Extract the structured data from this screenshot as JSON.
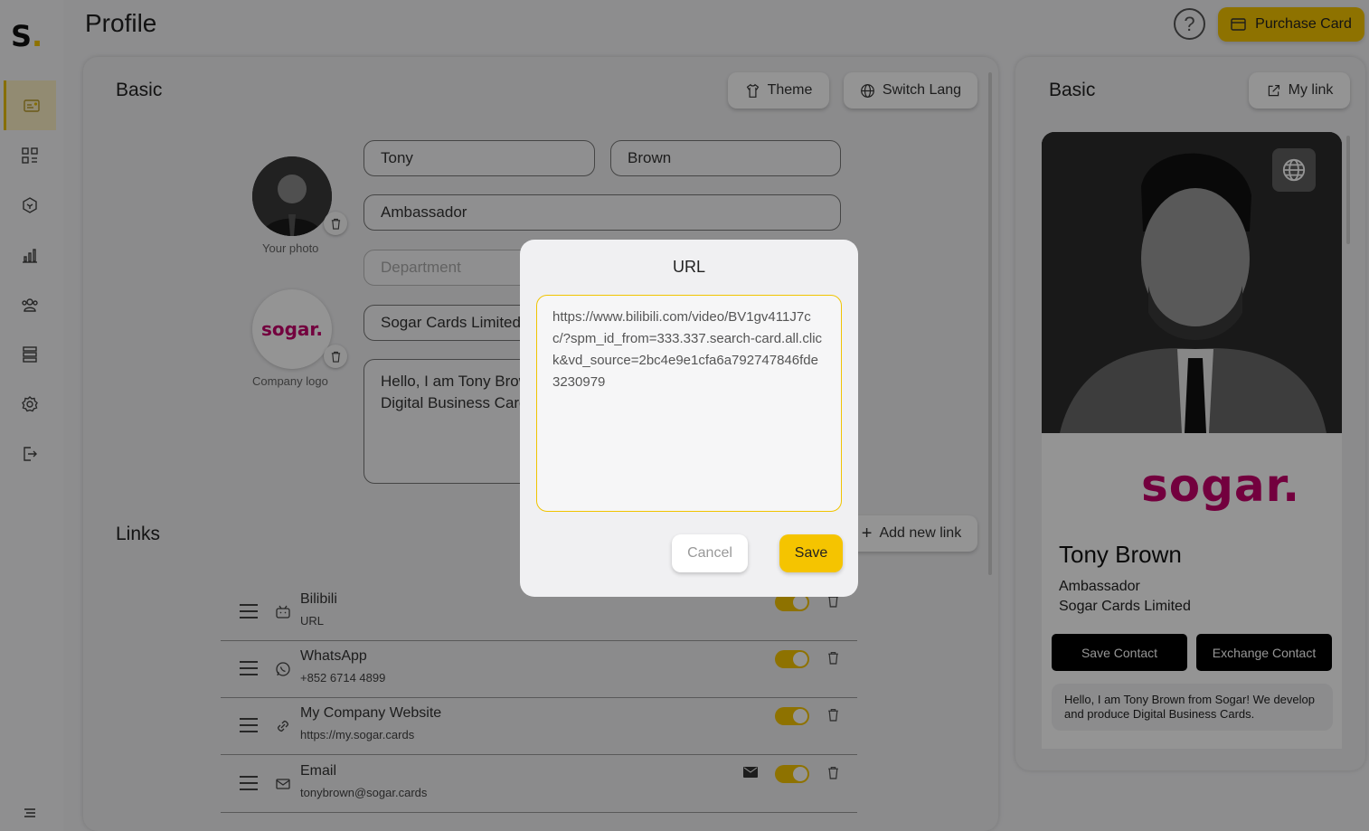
{
  "header": {
    "logo_text": "S",
    "logo_dot": ".",
    "title": "Profile",
    "help_symbol": "?",
    "purchase_label": "Purchase Card",
    "accent_color": "#f5c400"
  },
  "sidebar": {
    "items": [
      {
        "icon": "profile-card-icon",
        "active": true
      },
      {
        "icon": "apps-grid-icon",
        "active": false
      },
      {
        "icon": "hexagon-icon",
        "active": false
      },
      {
        "icon": "bar-chart-icon",
        "active": false
      },
      {
        "icon": "users-icon",
        "active": false
      },
      {
        "icon": "layers-icon",
        "active": false
      },
      {
        "icon": "settings-icon",
        "active": false
      },
      {
        "icon": "logout-icon",
        "active": false
      },
      {
        "icon": "menu-icon",
        "active": false
      }
    ]
  },
  "basic": {
    "title": "Basic",
    "theme_label": "Theme",
    "switch_lang_label": "Switch Lang",
    "photo_caption": "Your photo",
    "company_logo_caption": "Company logo",
    "company_logo_text": "sogar.",
    "first_name": "Tony",
    "last_name": "Brown",
    "job_title": "Ambassador",
    "department_placeholder": "Department",
    "company": "Sogar Cards Limited",
    "bio": "Hello, I am Tony Brown from Sogar! We develop and produce Digital Business Cards."
  },
  "links": {
    "title": "Links",
    "add_label": "Add new link",
    "rows": [
      {
        "label": "Bilibili",
        "value": "URL",
        "icon": "bilibili-icon",
        "enabled": true
      },
      {
        "label": "WhatsApp",
        "value": "+852 6714 4899",
        "icon": "whatsapp-icon",
        "enabled": true
      },
      {
        "label": "My Company Website",
        "value": "https://my.sogar.cards",
        "icon": "link-icon",
        "enabled": true
      },
      {
        "label": "Email",
        "value": "tonybrown@sogar.cards",
        "icon": "email-icon",
        "enabled": true
      }
    ]
  },
  "preview": {
    "title": "Basic",
    "my_link_label": "My link",
    "logo_text": "sogar.",
    "name": "Tony Brown",
    "job_title": "Ambassador",
    "company": "Sogar Cards Limited",
    "save_contact_label": "Save Contact",
    "exchange_contact_label": "Exchange Contact",
    "bio": "Hello, I am Tony Brown from Sogar! We develop and produce Digital Business Cards.",
    "brand_color": "#c7006b"
  },
  "modal": {
    "title": "URL",
    "url_value": "https://www.bilibili.com/video/BV1gv411J7cc/?spm_id_from=333.337.search-card.all.click&vd_source=2bc4e9e1cfa6a792747846fde3230979",
    "cancel_label": "Cancel",
    "save_label": "Save"
  }
}
